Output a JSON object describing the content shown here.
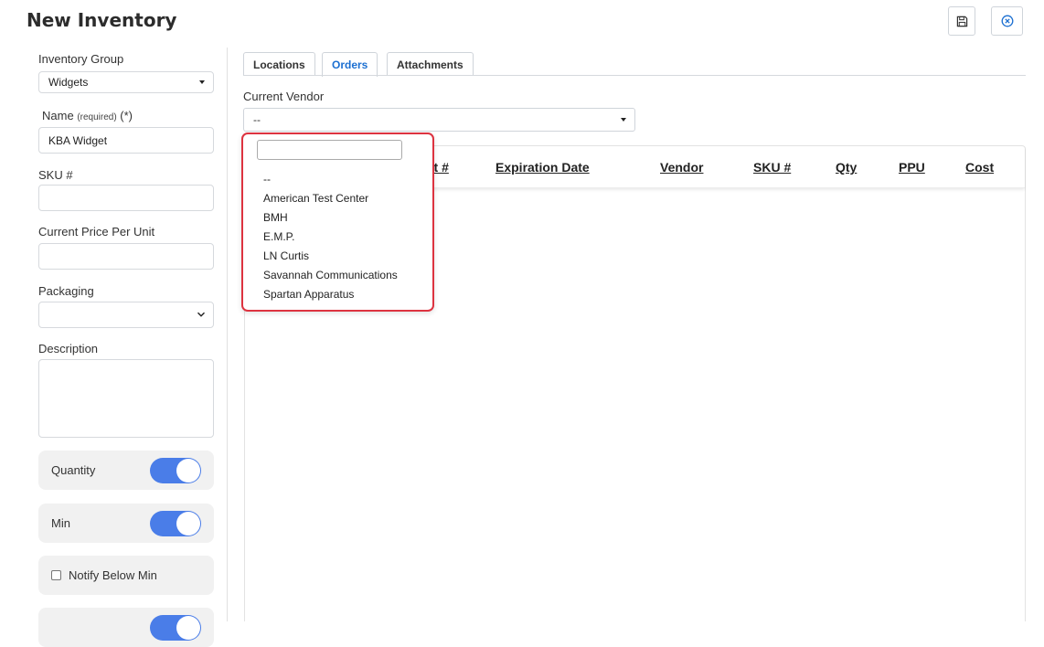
{
  "page": {
    "title": "New Inventory"
  },
  "header_actions": {
    "save_icon": "floppy-disk-icon",
    "close_icon": "circle-x-icon"
  },
  "left_form": {
    "inventory_group": {
      "label": "Inventory Group",
      "value": "Widgets"
    },
    "name": {
      "label": "Name",
      "required_note": "(required)",
      "asterisk": "(*)",
      "value": "KBA Widget"
    },
    "sku": {
      "label": "SKU #",
      "value": ""
    },
    "price_per_unit": {
      "label": "Current Price Per Unit",
      "value": ""
    },
    "packaging": {
      "label": "Packaging",
      "value": ""
    },
    "description": {
      "label": "Description",
      "value": ""
    },
    "quantity_toggle": {
      "label": "Quantity",
      "on": true
    },
    "min_toggle": {
      "label": "Min",
      "on": true
    },
    "notify_below_min": {
      "label": "Notify Below Min",
      "checked": false
    }
  },
  "tabs": [
    {
      "label": "Locations",
      "active": false
    },
    {
      "label": "Orders",
      "active": true
    },
    {
      "label": "Attachments",
      "active": false
    }
  ],
  "orders": {
    "current_vendor": {
      "label": "Current Vendor",
      "value": "--"
    },
    "vendor_dropdown": {
      "search_value": "",
      "options": [
        "--",
        "American Test Center",
        "BMH",
        "E.M.P.",
        "LN Curtis",
        "Savannah Communications",
        "Spartan Apparatus"
      ]
    },
    "table_columns": [
      "ot #",
      "Expiration Date",
      "Vendor",
      "SKU #",
      "Qty",
      "PPU",
      "Cost"
    ]
  },
  "colors": {
    "accent": "#4a7de8",
    "active_tab": "#1c6fd1",
    "highlight_border": "#dd3340"
  }
}
